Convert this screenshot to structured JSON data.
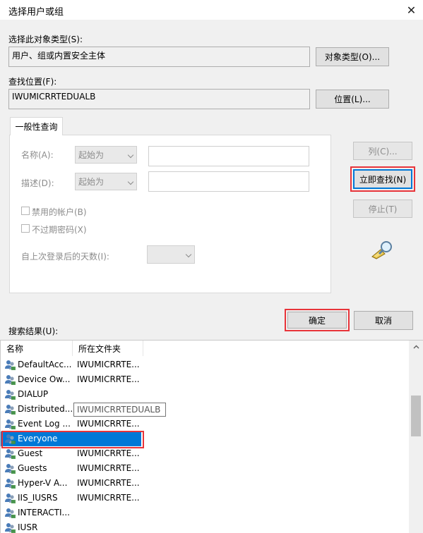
{
  "window": {
    "title": "选择用户或组",
    "close_glyph": "✕"
  },
  "object_type": {
    "label": "选择此对象类型(S):",
    "value": "用户、组或内置安全主体",
    "button": "对象类型(O)..."
  },
  "location": {
    "label": "查找位置(F):",
    "value": "IWUMICRRTEDUALB",
    "button": "位置(L)..."
  },
  "query_tab": {
    "label": "一般性查询"
  },
  "query": {
    "name_label": "名称(A):",
    "name_mode": "起始为",
    "desc_label": "描述(D):",
    "desc_mode": "起始为",
    "disabled_accounts": "禁用的帐户(B)",
    "non_expiring_pw": "不过期密码(X)",
    "days_label": "自上次登录后的天数(I):"
  },
  "buttons": {
    "columns": "列(C)...",
    "find_now": "立即查找(N)",
    "stop": "停止(T)",
    "ok": "确定",
    "cancel": "取消"
  },
  "results": {
    "label": "搜索结果(U):",
    "columns": [
      "名称",
      "所在文件夹"
    ],
    "rows": [
      {
        "name": "DefaultAcc...",
        "folder": "IWUMICRRTE..."
      },
      {
        "name": "Device Ow...",
        "folder": "IWUMICRRTE..."
      },
      {
        "name": "DIALUP",
        "folder": ""
      },
      {
        "name": "Distributed...",
        "folder": "IWUMICRRTEDUALB"
      },
      {
        "name": "Event Log ...",
        "folder": "IWUMICRRTE..."
      },
      {
        "name": "Everyone",
        "folder": ""
      },
      {
        "name": "Guest",
        "folder": "IWUMICRRTE..."
      },
      {
        "name": "Guests",
        "folder": "IWUMICRRTE..."
      },
      {
        "name": "Hyper-V A...",
        "folder": "IWUMICRRTE..."
      },
      {
        "name": "IIS_IUSRS",
        "folder": "IWUMICRRTE..."
      },
      {
        "name": "INTERACTI...",
        "folder": ""
      },
      {
        "name": "IUSR",
        "folder": ""
      }
    ],
    "selected_row": "Everyone"
  },
  "colors": {
    "highlight": "#e8343a",
    "selection": "#0078d7"
  },
  "icons": [
    "close-icon",
    "search-flashlight-icon",
    "user-group-icon",
    "scroll-up-icon"
  ]
}
